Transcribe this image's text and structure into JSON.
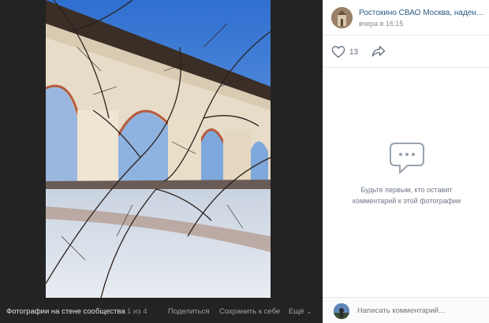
{
  "viewer": {
    "album_title": "Фотографии на стене сообщества",
    "counter": "1 из 4",
    "share_label": "Поделиться",
    "save_label": "Сохранить к себе",
    "more_label": "Ещё"
  },
  "post": {
    "author": "Ростокино СВАО Москва, надень ...",
    "time": "вчера в 16:15",
    "likes": "13"
  },
  "comments": {
    "empty_text": "Будьте первым, кто оставит комментарий к этой фотографии",
    "placeholder": "Написать комментарий..."
  },
  "colors": {
    "link": "#2a5885",
    "dark_bg": "#232324",
    "muted": "#818c99"
  },
  "icons": {
    "like": "heart-icon",
    "share": "share-arrow-icon",
    "empty": "speech-bubble-icon",
    "more": "chevron-down-icon"
  }
}
